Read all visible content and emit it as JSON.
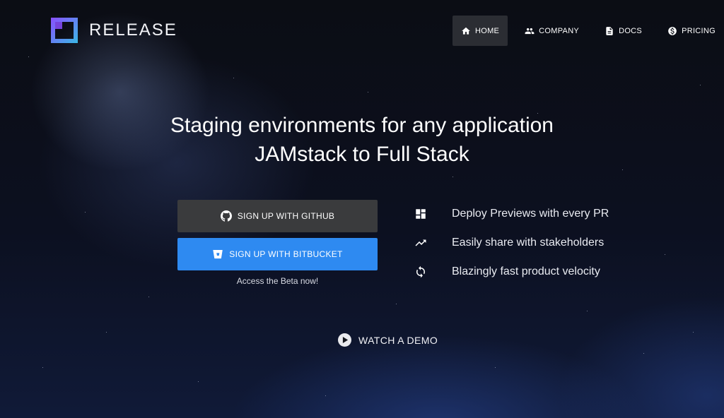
{
  "brand": {
    "name": "RELEASE"
  },
  "nav": {
    "items": [
      {
        "label": "HOME",
        "icon": "home-icon",
        "active": true
      },
      {
        "label": "COMPANY",
        "icon": "people-icon",
        "active": false
      },
      {
        "label": "DOCS",
        "icon": "document-icon",
        "active": false
      },
      {
        "label": "PRICING",
        "icon": "dollar-icon",
        "active": false
      }
    ]
  },
  "hero": {
    "title_line1": "Staging environments for any application",
    "title_line2": "JAMstack to Full Stack"
  },
  "cta": {
    "github_label": "SIGN UP WITH GITHUB",
    "bitbucket_label": "SIGN UP WITH BITBUCKET",
    "beta_text": "Access the Beta now!"
  },
  "features": [
    {
      "text": "Deploy Previews with every PR",
      "icon": "dashboard-icon"
    },
    {
      "text": "Easily share with stakeholders",
      "icon": "trending-up-icon"
    },
    {
      "text": "Blazingly fast product velocity",
      "icon": "sync-icon"
    }
  ],
  "demo": {
    "label": "WATCH A DEMO"
  },
  "colors": {
    "accent": "#2e8af1",
    "github_button": "#3a3b3d",
    "nav_active": "#2b2d33",
    "logo_gradient_start": "#8a4fff",
    "logo_gradient_end": "#3ab8e6"
  }
}
